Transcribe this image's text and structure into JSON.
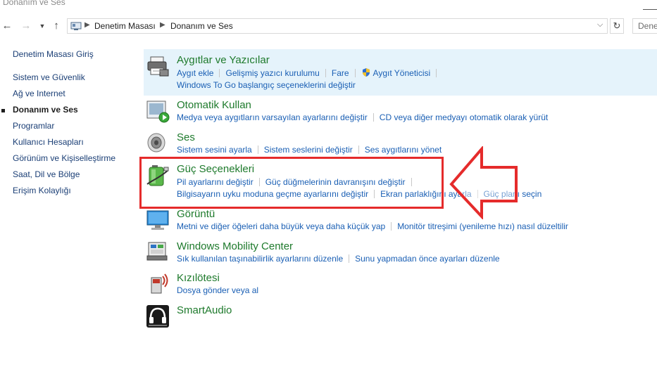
{
  "window": {
    "title": "Donanım ve Ses"
  },
  "address": {
    "crumbs": [
      "Denetim Masası",
      "Donanım ve Ses"
    ],
    "search_placeholder": "Dene"
  },
  "sidebar": {
    "items": [
      {
        "label": "Denetim Masası Giriş"
      },
      {
        "label": "Sistem ve Güvenlik"
      },
      {
        "label": "Ağ ve Internet"
      },
      {
        "label": "Donanım ve Ses",
        "active": true
      },
      {
        "label": "Programlar"
      },
      {
        "label": "Kullanıcı Hesapları"
      },
      {
        "label": "Görünüm ve Kişiselleştirme"
      },
      {
        "label": "Saat, Dil ve Bölge"
      },
      {
        "label": "Erişim Kolaylığı"
      }
    ]
  },
  "categories": [
    {
      "title": "Aygıtlar ve Yazıcılar",
      "icon": "printer-icon",
      "rows": [
        [
          "Aygıt ekle",
          "Gelişmiş yazıcı kurulumu",
          "Fare",
          "Aygıt Yöneticisi"
        ],
        [
          "Windows To Go başlangıç seçeneklerini değiştir"
        ]
      ]
    },
    {
      "title": "Otomatik Kullan",
      "icon": "autoplay-icon",
      "rows": [
        [
          "Medya veya aygıtların varsayılan ayarlarını değiştir",
          "CD veya diğer medyayı otomatik olarak yürüt"
        ]
      ]
    },
    {
      "title": "Ses",
      "icon": "speaker-icon",
      "rows": [
        [
          "Sistem sesini ayarla",
          "Sistem seslerini değiştir",
          "Ses aygıtlarını yönet"
        ]
      ]
    },
    {
      "title": "Güç Seçenekleri",
      "icon": "battery-icon",
      "rows": [
        [
          "Pil ayarlarını değiştir",
          "Güç düğmelerinin davranışını değiştir",
          ""
        ],
        [
          "Bilgisayarın uyku moduna geçme ayarlarını değiştir",
          "Ekran parlaklığını ayarla",
          "Güç planı seçin"
        ]
      ]
    },
    {
      "title": "Görüntü",
      "icon": "monitor-icon",
      "rows": [
        [
          "Metni ve diğer öğeleri daha büyük veya daha küçük yap",
          "Monitör titreşimi (yenileme hızı) nasıl düzeltilir"
        ]
      ]
    },
    {
      "title": "Windows Mobility Center",
      "icon": "mobility-icon",
      "rows": [
        [
          "Sık kullanılan taşınabilirlik ayarlarını düzenle",
          "Sunu yapmadan önce ayarları düzenle"
        ]
      ]
    },
    {
      "title": "Kızılötesi",
      "icon": "infrared-icon",
      "rows": [
        [
          "Dosya gönder veya al"
        ]
      ]
    },
    {
      "title": "SmartAudio",
      "icon": "headphones-icon",
      "rows": []
    }
  ],
  "colors": {
    "link": "#1a5fb4",
    "category_title": "#1e7a2c",
    "highlight": "#e5f3fb",
    "annotation_red": "#e52b2b"
  }
}
